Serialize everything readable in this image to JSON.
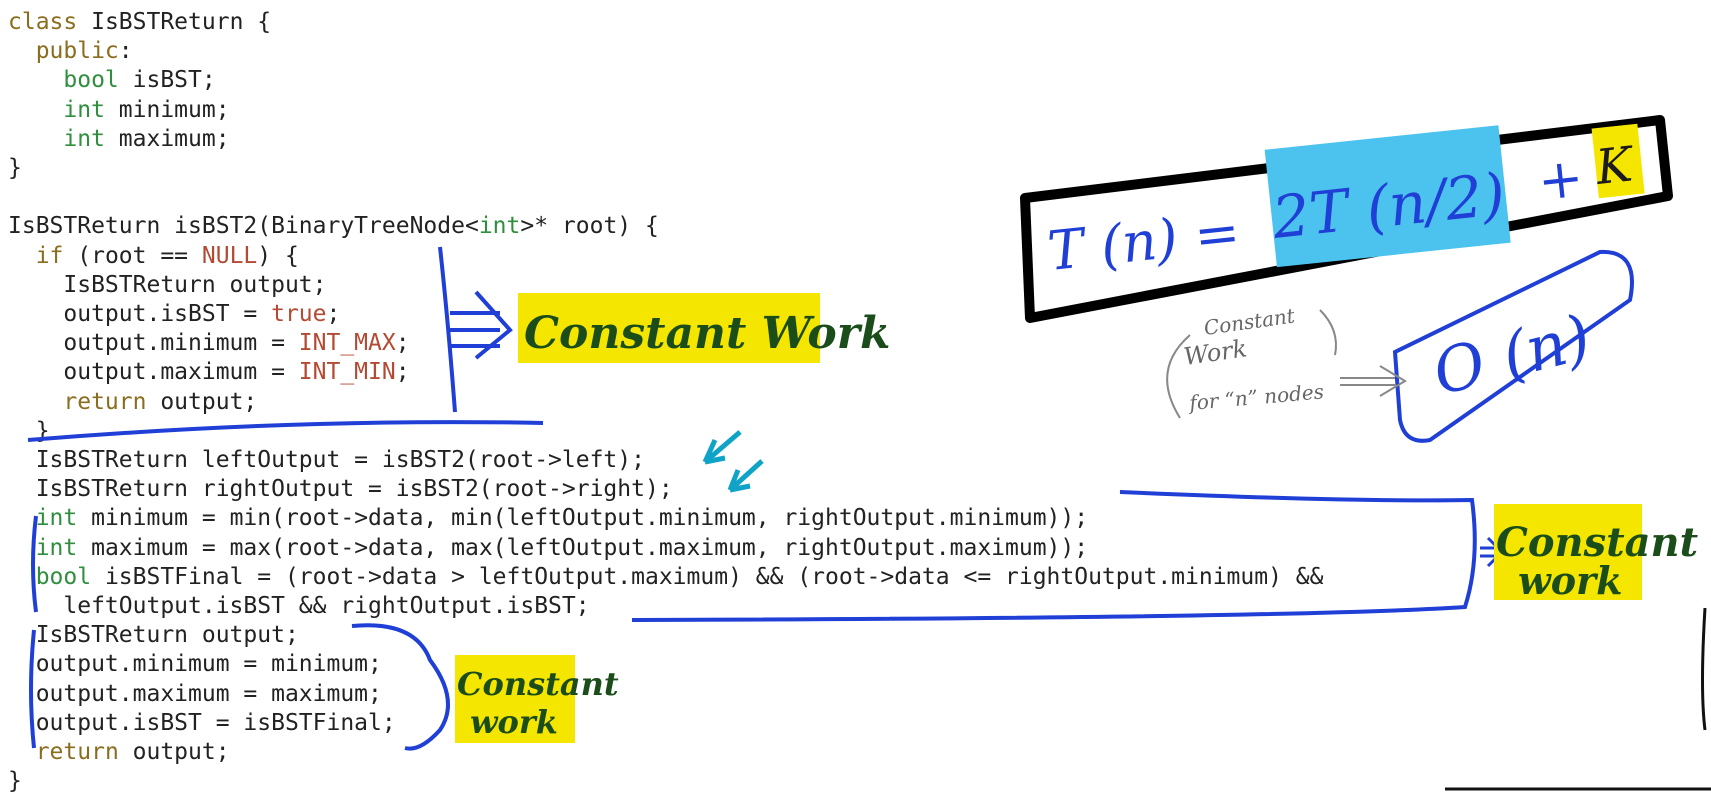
{
  "code_lines": [
    [
      {
        "t": "class ",
        "k": "kw"
      },
      {
        "t": "IsBSTReturn {",
        "k": "plain"
      }
    ],
    [
      {
        "t": "  public",
        "k": "kw"
      },
      {
        "t": ":",
        "k": "plain"
      }
    ],
    [
      {
        "t": "    ",
        "k": "plain"
      },
      {
        "t": "bool",
        "k": "type"
      },
      {
        "t": " isBST;",
        "k": "plain"
      }
    ],
    [
      {
        "t": "    ",
        "k": "plain"
      },
      {
        "t": "int",
        "k": "type"
      },
      {
        "t": " minimum;",
        "k": "plain"
      }
    ],
    [
      {
        "t": "    ",
        "k": "plain"
      },
      {
        "t": "int",
        "k": "type"
      },
      {
        "t": " maximum;",
        "k": "plain"
      }
    ],
    [
      {
        "t": "}",
        "k": "plain"
      }
    ],
    [
      {
        "t": "",
        "k": "plain"
      }
    ],
    [
      {
        "t": "IsBSTReturn isBST2(BinaryTreeNode<",
        "k": "plain"
      },
      {
        "t": "int",
        "k": "type"
      },
      {
        "t": ">* root) {",
        "k": "plain"
      }
    ],
    [
      {
        "t": "  ",
        "k": "plain"
      },
      {
        "t": "if",
        "k": "kw"
      },
      {
        "t": " (root == ",
        "k": "plain"
      },
      {
        "t": "NULL",
        "k": "lit"
      },
      {
        "t": ") {",
        "k": "plain"
      }
    ],
    [
      {
        "t": "    IsBSTReturn output;",
        "k": "plain"
      }
    ],
    [
      {
        "t": "    output.isBST = ",
        "k": "plain"
      },
      {
        "t": "true",
        "k": "lit"
      },
      {
        "t": ";",
        "k": "plain"
      }
    ],
    [
      {
        "t": "    output.minimum = ",
        "k": "plain"
      },
      {
        "t": "INT_MAX",
        "k": "lit"
      },
      {
        "t": ";",
        "k": "plain"
      }
    ],
    [
      {
        "t": "    output.maximum = ",
        "k": "plain"
      },
      {
        "t": "INT_MIN",
        "k": "lit"
      },
      {
        "t": ";",
        "k": "plain"
      }
    ],
    [
      {
        "t": "    ",
        "k": "plain"
      },
      {
        "t": "return",
        "k": "kw"
      },
      {
        "t": " output;",
        "k": "plain"
      }
    ],
    [
      {
        "t": "  }",
        "k": "plain"
      }
    ],
    [
      {
        "t": "  IsBSTReturn leftOutput = isBST2(root->left);",
        "k": "plain"
      }
    ],
    [
      {
        "t": "  IsBSTReturn rightOutput = isBST2(root->right);",
        "k": "plain"
      }
    ],
    [
      {
        "t": "  ",
        "k": "plain"
      },
      {
        "t": "int",
        "k": "type"
      },
      {
        "t": " minimum = min(root->data, min(leftOutput.minimum, rightOutput.minimum));",
        "k": "plain"
      }
    ],
    [
      {
        "t": "  ",
        "k": "plain"
      },
      {
        "t": "int",
        "k": "type"
      },
      {
        "t": " maximum = max(root->data, max(leftOutput.maximum, rightOutput.maximum));",
        "k": "plain"
      }
    ],
    [
      {
        "t": "  ",
        "k": "plain"
      },
      {
        "t": "bool",
        "k": "type"
      },
      {
        "t": " isBSTFinal = (root->data > leftOutput.maximum) && (root->data <= rightOutput.minimum) &&",
        "k": "plain"
      }
    ],
    [
      {
        "t": "    leftOutput.isBST && rightOutput.isBST;",
        "k": "plain"
      }
    ],
    [
      {
        "t": "  IsBSTReturn output;",
        "k": "plain"
      }
    ],
    [
      {
        "t": "  output.minimum = minimum;",
        "k": "plain"
      }
    ],
    [
      {
        "t": "  output.maximum = maximum;",
        "k": "plain"
      }
    ],
    [
      {
        "t": "  output.isBST = isBSTFinal;",
        "k": "plain"
      }
    ],
    [
      {
        "t": "  ",
        "k": "plain"
      },
      {
        "t": "return",
        "k": "kw"
      },
      {
        "t": " output;",
        "k": "plain"
      }
    ],
    [
      {
        "t": "}",
        "k": "plain"
      }
    ]
  ],
  "annotations": {
    "constant_work_1": "Constant Work",
    "constant_work_2_line1": "Constant",
    "constant_work_2_line2": "work",
    "constant_work_3_line1": "Constant",
    "constant_work_3_line2": "work",
    "recurrence_lhs": "T (n) =",
    "recurrence_term": "2T (n/2)",
    "recurrence_plus": "+",
    "recurrence_const": "K",
    "big_o": "O (n)",
    "note_line1": "Constant",
    "note_line2": "Work",
    "note_line3": "for “n” nodes"
  },
  "colors": {
    "keyword": "#8a6d1e",
    "type": "#2f8f3f",
    "literal": "#b44a33",
    "ink_blue": "#1f3fd6",
    "ink_cyan": "#0fa3c8",
    "highlight_yellow": "#f5e600",
    "highlight_cyan": "#4cc3ee",
    "note_green": "#1b4d1b"
  }
}
